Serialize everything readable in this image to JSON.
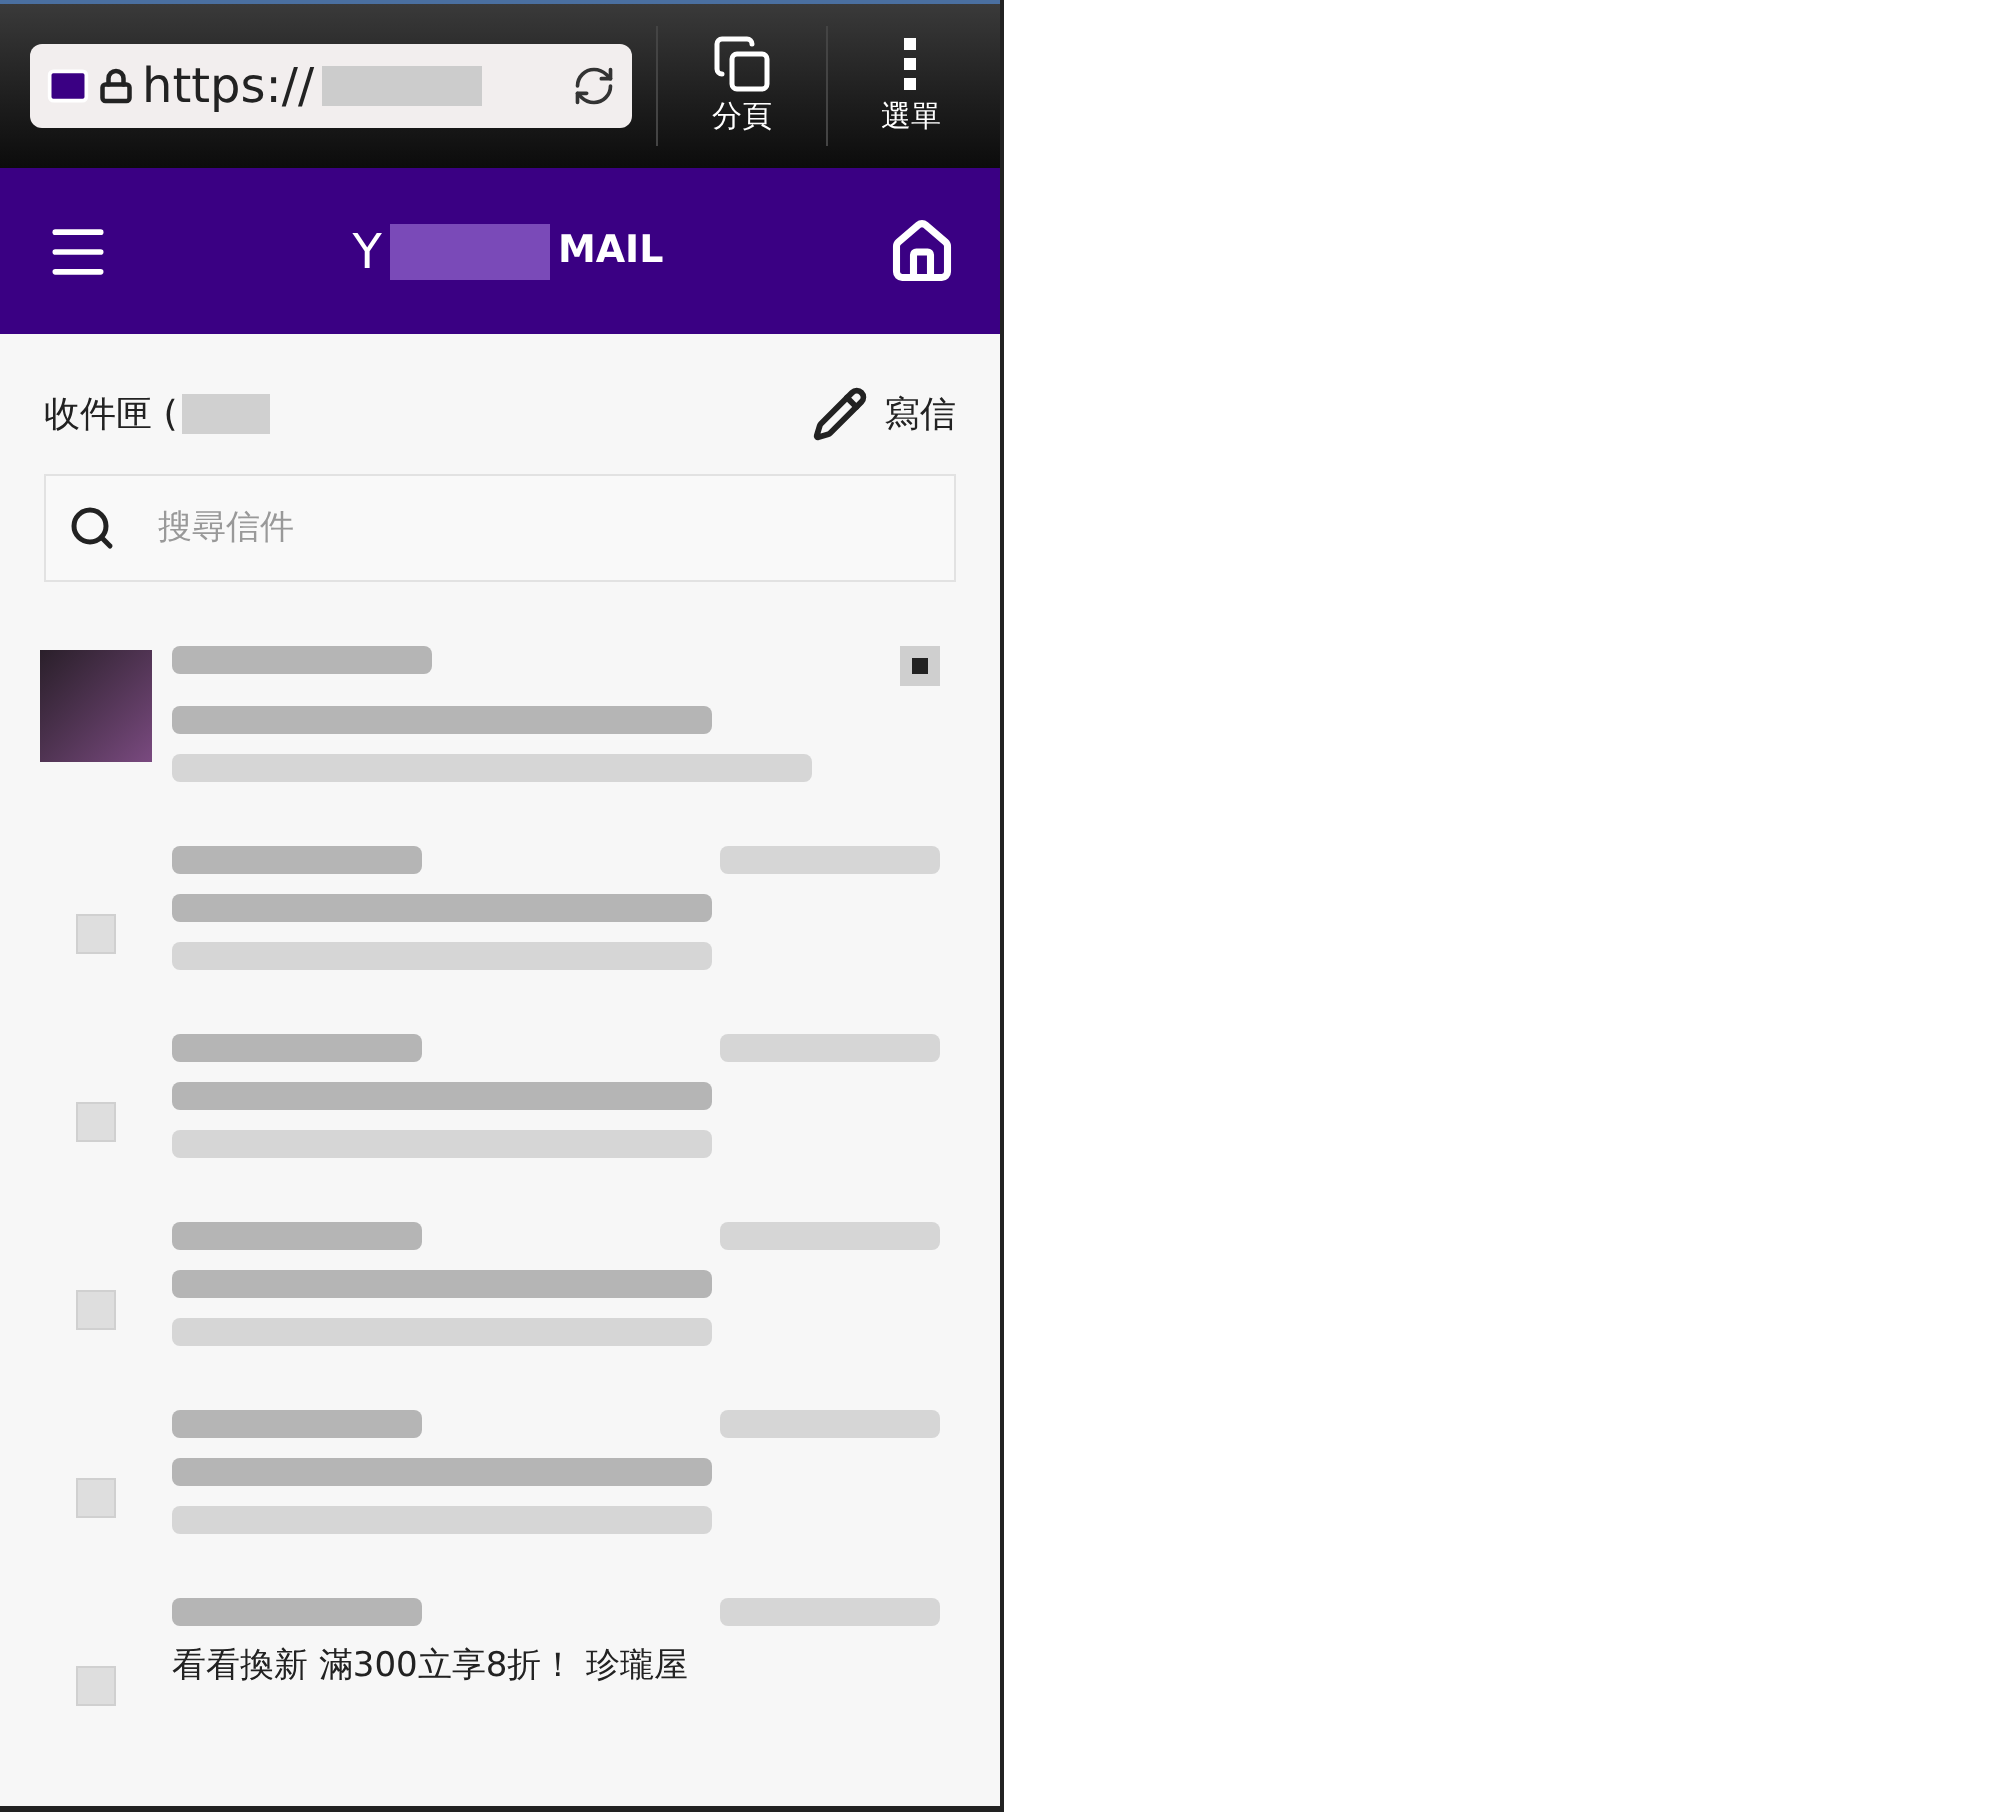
{
  "browser": {
    "url": "https://",
    "tabs_label": "分頁",
    "menu_label": "選單"
  },
  "header": {
    "logo_start": "Y",
    "logo_end": "MAIL"
  },
  "inbox": {
    "title": "收件匣 (",
    "compose_label": "寫信",
    "search": {
      "placeholder": "搜尋信件"
    }
  },
  "messages": [
    {
      "kind": "avatar"
    },
    {
      "kind": "checkbox",
      "checked": false
    },
    {
      "kind": "checkbox",
      "checked": false
    },
    {
      "kind": "checkbox",
      "checked": false
    },
    {
      "kind": "checkbox",
      "checked": false
    },
    {
      "kind": "checkbox",
      "checked": false,
      "subject": "看看換新 滿300立享8折！ 珍瓏屋"
    }
  ]
}
